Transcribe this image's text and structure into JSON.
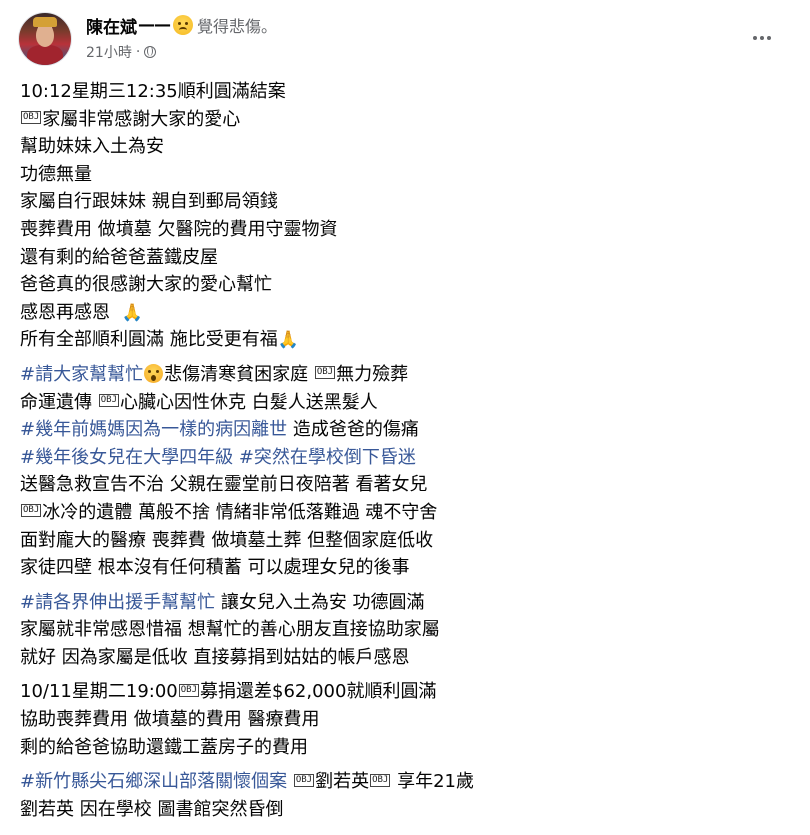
{
  "header": {
    "author": "陳在斌",
    "dash": "——",
    "feeling_emoji": "sad-face-emoji",
    "feeling": "覺得悲傷。",
    "time": "21小時",
    "dot": "·",
    "privacy_icon": "globe-icon",
    "more_icon": "more-horizontal-icon"
  },
  "body": {
    "p1": {
      "l1": "10:12星期三12:35順利圓滿結案",
      "l2": "家屬非常感謝大家的愛心",
      "l3": "幫助妹妹入土為安",
      "l4": "功德無量",
      "l5": "家屬自行跟妹妹 親自到郵局領錢",
      "l6": "喪葬費用 做墳墓 欠醫院的費用守靈物資",
      "l7": "還有剩的給爸爸蓋鐵皮屋",
      "l8": "爸爸真的很感謝大家的愛心幫忙",
      "l9": "感恩再感恩",
      "l10": "所有全部順利圓滿 施比受更有福"
    },
    "p2": {
      "l1_tag": "#請大家幫幫忙",
      "l1_rest_a": "悲傷清寒貧困家庭",
      "l1_rest_b": "無力殮葬",
      "l2_a": "命運遺傳",
      "l2_b": "心臟心因性休克 白髮人送黑髮人",
      "l3_tag": "#幾年前媽媽因為一樣的病因離世",
      "l3_rest": " 造成爸爸的傷痛",
      "l4_tag1": "#幾年後女兒在大學四年級",
      "l4_tag2": "#突然在學校倒下昏迷",
      "l5": "送醫急救宣告不治 父親在靈堂前日夜陪著 看著女兒",
      "l6": "冰冷的遺體 萬般不捨 情緒非常低落難過 魂不守舍",
      "l7": "面對龐大的醫療 喪葬費 做墳墓土葬 但整個家庭低收",
      "l8": "家徒四壁 根本沒有任何積蓄 可以處理女兒的後事"
    },
    "p3": {
      "l1_tag": "#請各界伸出援手幫幫忙",
      "l1_rest": " 讓女兒入土為安 功德圓滿",
      "l2": "家屬就非常感恩惜福 想幫忙的善心朋友直接協助家屬",
      "l3": "就好 因為家屬是低收 直接募捐到姑姑的帳戶感恩"
    },
    "p4": {
      "l1_a": "10/11星期二19:00",
      "l1_b": "募捐還差$62,000就順利圓滿",
      "l2": "協助喪葬費用 做墳墓的費用 醫療費用",
      "l3": "剩的給爸爸協助還鐵工蓋房子的費用"
    },
    "p5": {
      "l1_tag": "#新竹縣尖石鄉深山部落關懷個案",
      "l1_b": "劉若英",
      "l1_c": " 享年21歲",
      "l2": "劉若英 因在學校 圖書館突然昏倒"
    },
    "obj_glyph": "OBJ",
    "pray_glyph": "🙏"
  }
}
